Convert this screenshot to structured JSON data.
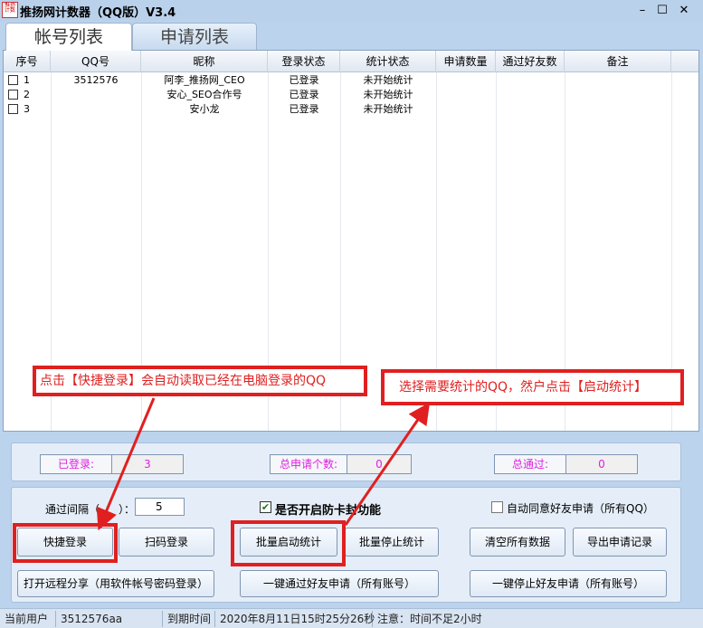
{
  "window": {
    "title": "推扬网计数器（QQ版）V3.4",
    "icon_text": "推扬计数",
    "minimize": "–",
    "maximize": "☐",
    "close": "✕"
  },
  "tabs": [
    {
      "label": "帐号列表",
      "active": true
    },
    {
      "label": "申请列表",
      "active": false
    }
  ],
  "table": {
    "columns": [
      "序号",
      "QQ号",
      "昵称",
      "登录状态",
      "统计状态",
      "申请数量",
      "通过好友数",
      "备注"
    ],
    "rows": [
      {
        "index": "1",
        "qq": "3512576",
        "nickname": "阿李_推扬网_CEO",
        "login": "已登录",
        "stat": "未开始统计",
        "applies": "",
        "passed": "",
        "note": ""
      },
      {
        "index": "2",
        "qq": "",
        "nickname": "安心_SEO合作号",
        "login": "已登录",
        "stat": "未开始统计",
        "applies": "",
        "passed": "",
        "note": ""
      },
      {
        "index": "3",
        "qq": "",
        "nickname": "安小龙",
        "login": "已登录",
        "stat": "未开始统计",
        "applies": "",
        "passed": "",
        "note": ""
      }
    ]
  },
  "stats": {
    "logged_in_label": "已登录:",
    "logged_in_value": "3",
    "total_apply_label": "总申请个数:",
    "total_apply_value": "0",
    "total_pass_label": "总通过:",
    "total_pass_value": "0"
  },
  "controls": {
    "interval_label_left": "通过间隔（",
    "interval_label_right": "）：",
    "interval_value": "5",
    "anti_card_label": "是否开启防卡封功能",
    "anti_card_checked": true,
    "auto_agree_label": "自动同意好友申请（所有QQ）",
    "auto_agree_checked": false,
    "quick_login": "快捷登录",
    "scan_login": "扫码登录",
    "batch_start": "批量启动统计",
    "batch_stop": "批量停止统计",
    "clear_data": "清空所有数据",
    "export_records": "导出申请记录",
    "remote_share": "打开远程分享（用软件帐号密码登录）",
    "pass_all": "一键通过好友申请（所有账号）",
    "stop_all": "一键停止好友申请（所有账号）"
  },
  "annotations": {
    "left": "点击【快捷登录】会自动读取已经在电脑登录的QQ",
    "right": "选择需要统计的QQ，然户点击【启动统计】"
  },
  "statusbar": {
    "current_user_label": "当前用户",
    "current_user": "3512576aa",
    "expire_label": "到期时间",
    "expire_time": "2020年8月11日15时25分26秒",
    "notice": "注意：时间不足2小时"
  },
  "colors": {
    "annotation_red": "#e02020",
    "stat_magenta": "#e020e0",
    "window_bg": "#bcd3ee"
  }
}
